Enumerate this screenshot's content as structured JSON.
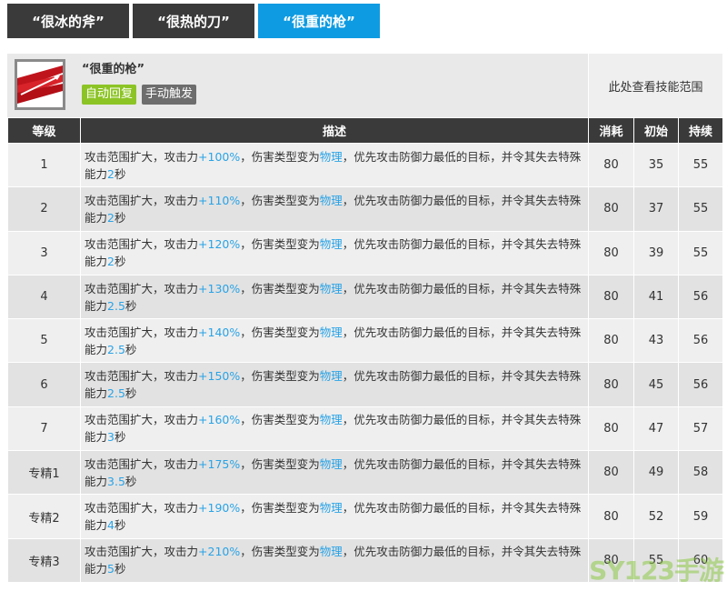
{
  "tabs": [
    {
      "label": "“很冰的斧”",
      "active": false
    },
    {
      "label": "“很热的刀”",
      "active": false
    },
    {
      "label": "“很重的枪”",
      "active": true
    }
  ],
  "skill": {
    "name": "“很重的枪”",
    "tags": [
      "自动回复",
      "手动触发"
    ],
    "range_hint": "此处查看技能范围"
  },
  "table": {
    "headers": [
      "等级",
      "描述",
      "消耗",
      "初始",
      "持续"
    ],
    "desc_parts": {
      "p1": "攻击范围扩大，攻击力",
      "p2": "，伤害类型变为",
      "type": "物理",
      "p3": "，优先攻击防御力最低的目标，并令其失去特殊能力",
      "p4": "秒"
    },
    "rows": [
      {
        "level": "1",
        "atk": "+100%",
        "dur_text": "2",
        "cost": "80",
        "init": "35",
        "last": "55"
      },
      {
        "level": "2",
        "atk": "+110%",
        "dur_text": "2",
        "cost": "80",
        "init": "37",
        "last": "55"
      },
      {
        "level": "3",
        "atk": "+120%",
        "dur_text": "2",
        "cost": "80",
        "init": "39",
        "last": "55"
      },
      {
        "level": "4",
        "atk": "+130%",
        "dur_text": "2.5",
        "cost": "80",
        "init": "41",
        "last": "56"
      },
      {
        "level": "5",
        "atk": "+140%",
        "dur_text": "2.5",
        "cost": "80",
        "init": "43",
        "last": "56"
      },
      {
        "level": "6",
        "atk": "+150%",
        "dur_text": "2.5",
        "cost": "80",
        "init": "45",
        "last": "56"
      },
      {
        "level": "7",
        "atk": "+160%",
        "dur_text": "3",
        "cost": "80",
        "init": "47",
        "last": "57"
      },
      {
        "level": "专精1",
        "atk": "+175%",
        "dur_text": "3.5",
        "cost": "80",
        "init": "49",
        "last": "58"
      },
      {
        "level": "专精2",
        "atk": "+190%",
        "dur_text": "4",
        "cost": "80",
        "init": "52",
        "last": "59"
      },
      {
        "level": "专精3",
        "atk": "+210%",
        "dur_text": "5",
        "cost": "80",
        "init": "55",
        "last": "60"
      }
    ]
  },
  "watermark": "SY123手游",
  "colors": {
    "accent": "#0e9be2",
    "highlight": "#29a3e6",
    "tag_green": "#8cc426",
    "tag_grey": "#6d6d6d",
    "header_dark": "#3a3a3a"
  }
}
